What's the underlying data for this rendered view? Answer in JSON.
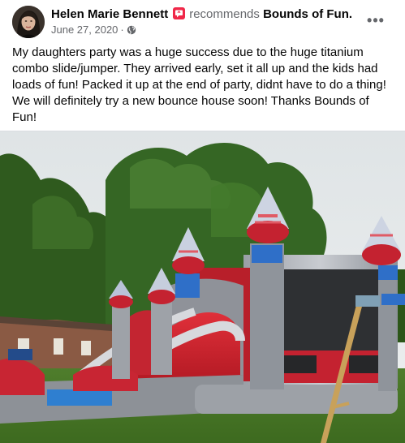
{
  "post": {
    "author_name": "Helen Marie Bennett",
    "recommend_verb": "recommends",
    "page_name": "Bounds of Fun.",
    "date": "June 27, 2020",
    "date_separator": "·",
    "privacy_icon": "globe-icon",
    "more_icon": "more-options-icon",
    "more_label": "•••",
    "body_text": "My daughters party was a huge success due to the huge titanium combo slide/jumper. They arrived early, set it all up and the kids had loads of fun! Packed it up at the end of party, didnt have to do a thing! We will definitely try a new bounce house soon! Thanks Bounds of Fun!"
  },
  "colors": {
    "recommend_badge": "#f02849",
    "secondary_text": "#65676b",
    "primary_text": "#050505"
  }
}
